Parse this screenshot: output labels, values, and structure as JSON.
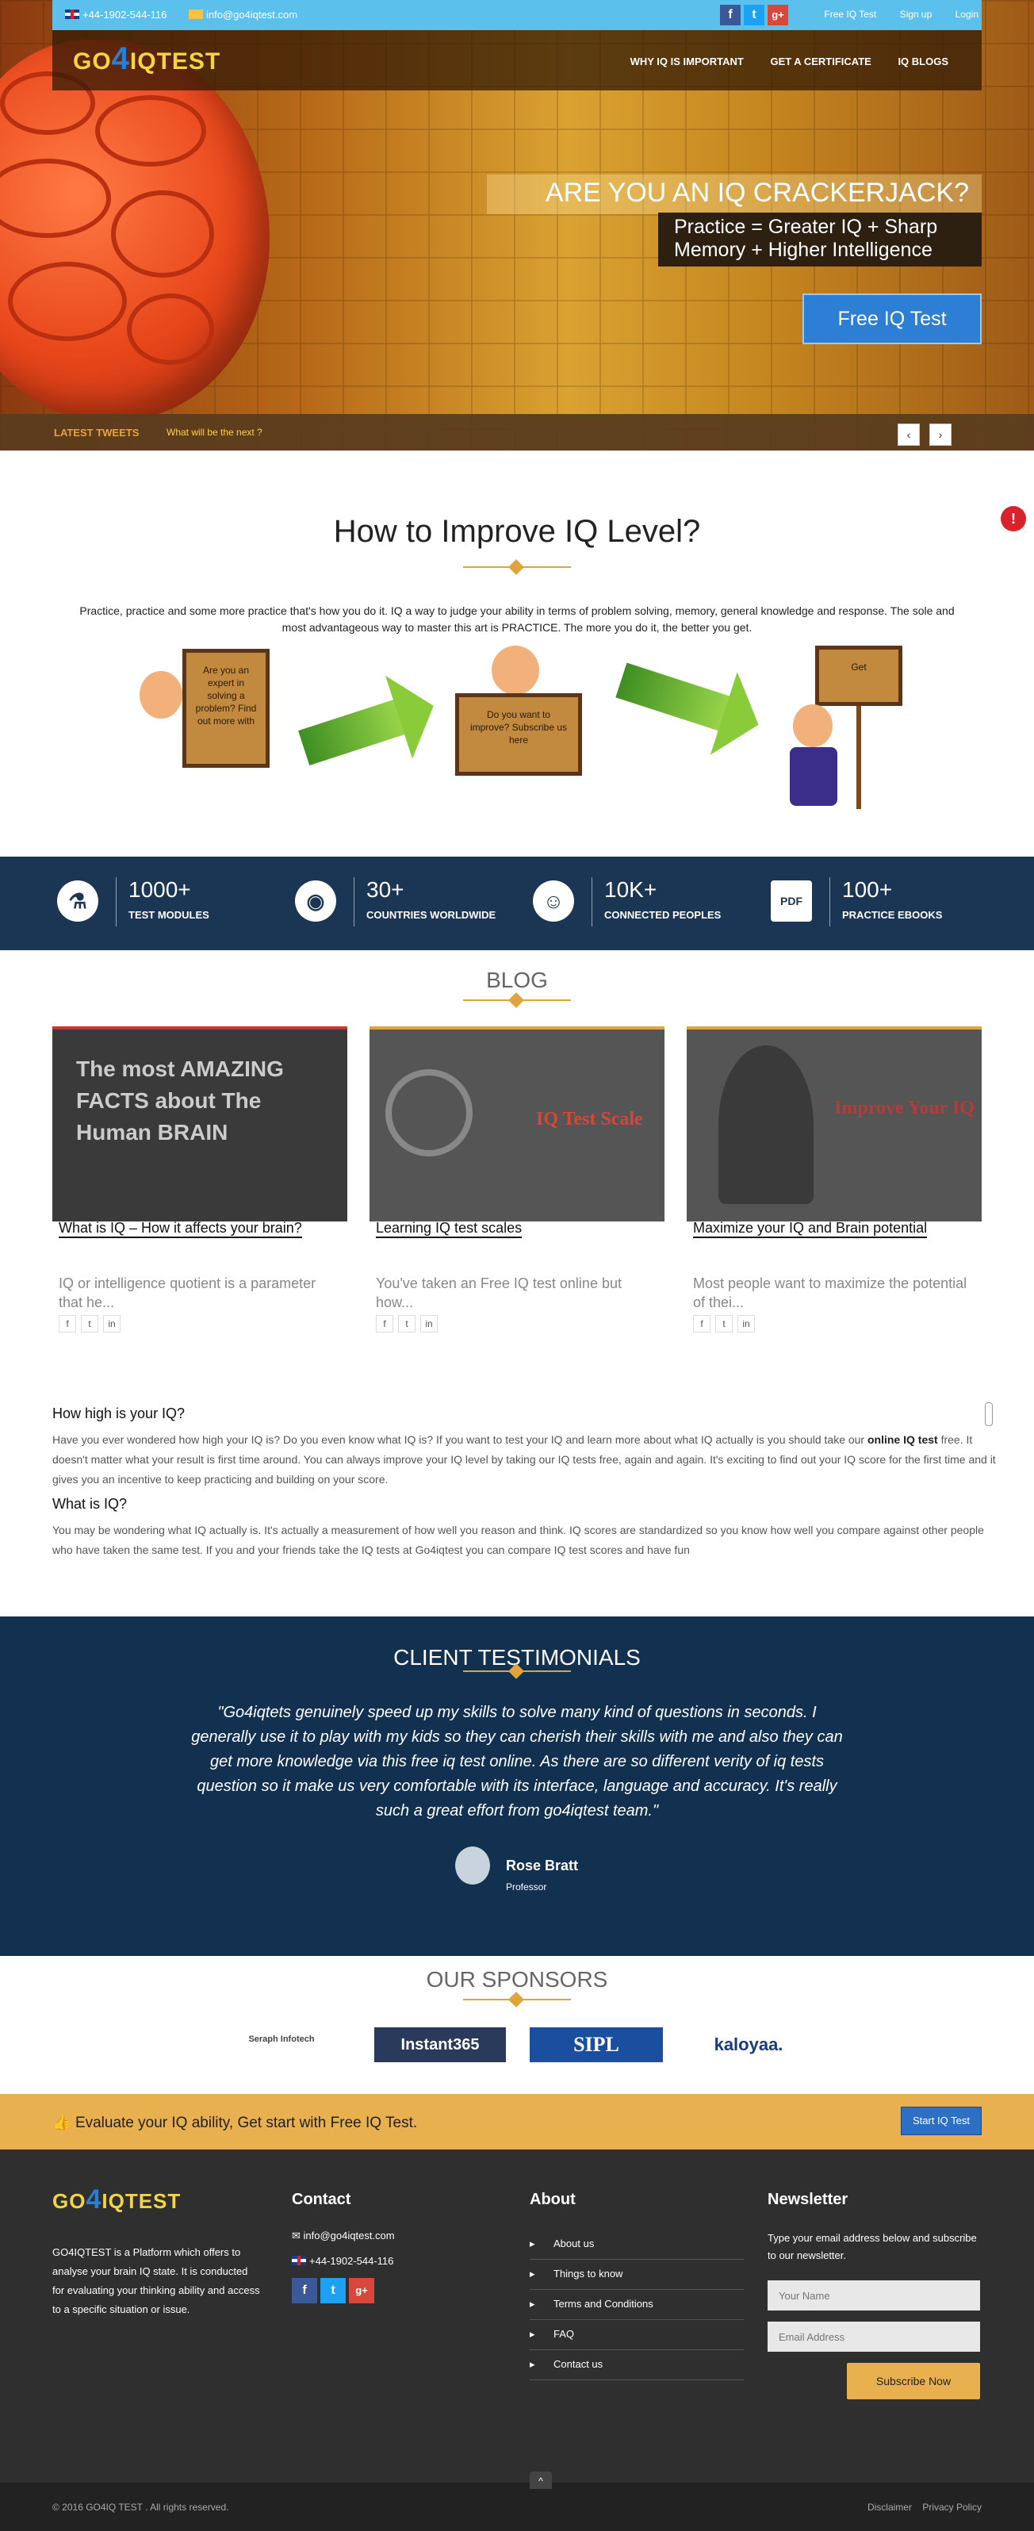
{
  "topbar": {
    "phone": "+44-1902-544-116",
    "email": "info@go4iqtest.com",
    "links": [
      "Free IQ Test",
      "Sign up",
      "Login"
    ]
  },
  "logo": {
    "text": "G04IQTEST"
  },
  "nav": [
    "WHY IQ IS IMPORTANT",
    "GET A CERTIFICATE",
    "IQ BLOGS"
  ],
  "hero": {
    "question": "ARE YOU AN IQ CRACKERJACK?",
    "subtitle": "Practice = Greater IQ + Sharp Memory + Higher Intelligence",
    "button": "Free IQ Test"
  },
  "tweets": {
    "label": "LATEST TWEETS",
    "text": "What will be the next ?",
    "prev": "‹",
    "next": "›"
  },
  "improve": {
    "title": "How to Improve IQ Level?",
    "text": "Practice, practice and some more practice that's how you do it. IQ a way to judge your ability in terms of problem solving, memory, general knowledge and response. The sole and most advantageous way to master this art is PRACTICE. The more you do it, the better you get.",
    "board1": "Are you an expert in solving a problem? Find out more with",
    "board2": "Do you want to improve? Subscribe us here",
    "board3": "Get"
  },
  "stats": [
    {
      "num": "1000+",
      "cap": "TEST MODULES",
      "icon": "flask-icon"
    },
    {
      "num": "30+",
      "cap": "COUNTRIES WORLDWIDE",
      "icon": "globe-icon"
    },
    {
      "num": "10K+",
      "cap": "CONNECTED PEOPLES",
      "icon": "people-icon"
    },
    {
      "num": "100+",
      "cap": "PRACTICE EBOOKS",
      "icon": "pdf-icon"
    }
  ],
  "blog": {
    "title": "BLOG",
    "posts": [
      {
        "title": "What is IQ – How it affects your brain?",
        "excerpt": "IQ or intelligence quotient is a parameter that he...",
        "image_text": "The most AMAZING FACTS about The Human BRAIN"
      },
      {
        "title": "Learning IQ test scales",
        "excerpt": "You've taken an Free IQ test online but how...",
        "image_text": "IQ Test Scale"
      },
      {
        "title": "Maximize your IQ and Brain potential",
        "excerpt": "Most people want to maximize the potential of thei...",
        "image_text": "Improve Your IQ"
      }
    ]
  },
  "faq": {
    "h1": "How high is your IQ?",
    "p1a": "Have you ever wondered how high your IQ is? Do you even know what IQ is? If you want to test your IQ and learn more about what IQ actually is you should take our ",
    "p1b": "online IQ test",
    "p1c": " free. It doesn't matter what your result is first time around. You can always improve your IQ level by taking our IQ tests free, again and again. It's exciting to find out your IQ score for the first time and it gives you an incentive to keep practicing and building on your score.",
    "h2": "What is IQ?",
    "p2": "You may be wondering what IQ actually is. It's actually a measurement of how well you reason and think. IQ scores are standardized so you know how well you compare against other people who have taken the same test. If you and your friends take the IQ tests at Go4iqtest you can compare IQ test scores and have fun"
  },
  "testimonials": {
    "title": "CLIENT TESTIMONIALS",
    "quote": "\"Go4iqtets genuinely speed up my skills to solve many kind of questions in seconds. I generally use it to play with my kids so they can cherish their skills with me and also they can get more knowledge via this free iq test online. As there are so different verity of iq tests question so it make us very comfortable with its interface, language and accuracy. It's really such a great effort from go4iqtest team.\"",
    "name": "Rose Bratt",
    "role": "Professor"
  },
  "sponsors": {
    "title": "OUR SPONSORS",
    "items": [
      "Seraph Infotech",
      "Instant365",
      "SIPL",
      "kaloyaa."
    ]
  },
  "cta": {
    "text": "Evaluate your IQ ability, Get start with Free IQ Test.",
    "button": "Start IQ Test"
  },
  "footer": {
    "about_text": "GO4IQTEST is a Platform which offers to analyse your brain IQ state. It is conducted for evaluating your thinking ability and access to a specific situation or issue.",
    "contact_title": "Contact",
    "contact_email": "info@go4iqtest.com",
    "contact_phone": "+44-1902-544-116",
    "about_title": "About",
    "about_links": [
      "About us",
      "Things to know",
      "Terms and Conditions",
      "FAQ",
      "Contact us"
    ],
    "newsletter_title": "Newsletter",
    "newsletter_text": "Type your email address below and subscribe to our newsletter.",
    "name_placeholder": "Your Name",
    "email_placeholder": "Email Address",
    "subscribe": "Subscribe Now",
    "copyright": "© 2016 GO4IQ TEST . All rights reserved.",
    "disclaimer": "Disclaimer",
    "privacy": "Privacy Policy",
    "top": "^"
  },
  "colors": {
    "accent": "#e8b04f",
    "navy": "#123050",
    "topbar": "#5bc0eb",
    "button_blue": "#2d7fd6"
  }
}
